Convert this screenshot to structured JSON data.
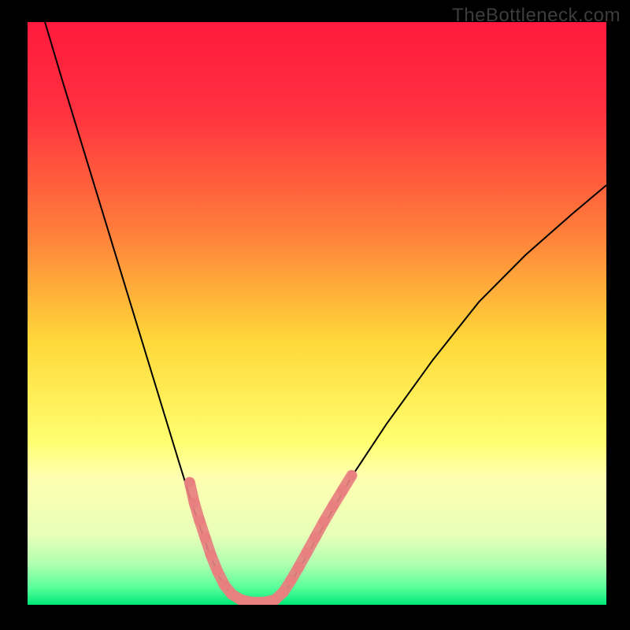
{
  "watermark": "TheBottleneck.com",
  "chart_data": {
    "type": "line",
    "title": "",
    "xlabel": "",
    "ylabel": "",
    "xlim": [
      0,
      100
    ],
    "ylim": [
      0,
      100
    ],
    "gradient_stops": [
      {
        "offset": 0.0,
        "color": "#ff1a3d"
      },
      {
        "offset": 0.15,
        "color": "#ff3040"
      },
      {
        "offset": 0.35,
        "color": "#ff7a3a"
      },
      {
        "offset": 0.55,
        "color": "#ffd93a"
      },
      {
        "offset": 0.72,
        "color": "#ffff70"
      },
      {
        "offset": 0.78,
        "color": "#ffffb0"
      },
      {
        "offset": 0.88,
        "color": "#e8ffb8"
      },
      {
        "offset": 0.93,
        "color": "#b0ffb0"
      },
      {
        "offset": 0.97,
        "color": "#5aff9a"
      },
      {
        "offset": 1.0,
        "color": "#00e878"
      }
    ],
    "series": [
      {
        "name": "curve",
        "stroke": "#000000",
        "points": [
          {
            "x": 3.0,
            "y": 100.0
          },
          {
            "x": 6.0,
            "y": 90.0
          },
          {
            "x": 10.0,
            "y": 77.0
          },
          {
            "x": 14.0,
            "y": 64.0
          },
          {
            "x": 18.0,
            "y": 51.0
          },
          {
            "x": 22.0,
            "y": 38.0
          },
          {
            "x": 26.0,
            "y": 25.0
          },
          {
            "x": 28.5,
            "y": 17.0
          },
          {
            "x": 31.0,
            "y": 10.0
          },
          {
            "x": 33.0,
            "y": 5.0
          },
          {
            "x": 35.0,
            "y": 2.0
          },
          {
            "x": 37.5,
            "y": 0.5
          },
          {
            "x": 40.0,
            "y": 0.3
          },
          {
            "x": 42.5,
            "y": 0.5
          },
          {
            "x": 45.0,
            "y": 3.0
          },
          {
            "x": 48.0,
            "y": 8.0
          },
          {
            "x": 52.0,
            "y": 15.0
          },
          {
            "x": 56.0,
            "y": 22.0
          },
          {
            "x": 62.0,
            "y": 31.0
          },
          {
            "x": 70.0,
            "y": 42.0
          },
          {
            "x": 78.0,
            "y": 52.0
          },
          {
            "x": 86.0,
            "y": 60.0
          },
          {
            "x": 94.0,
            "y": 67.0
          },
          {
            "x": 100.0,
            "y": 72.0
          }
        ]
      },
      {
        "name": "overlay-dots",
        "stroke": "#e88080",
        "fill": "#e88080",
        "radius_px": 6,
        "points": [
          {
            "x": 28.0,
            "y": 21.0
          },
          {
            "x": 28.8,
            "y": 17.5
          },
          {
            "x": 29.7,
            "y": 14.5
          },
          {
            "x": 30.7,
            "y": 11.5
          },
          {
            "x": 31.7,
            "y": 8.5
          },
          {
            "x": 32.8,
            "y": 5.8
          },
          {
            "x": 34.0,
            "y": 3.4
          },
          {
            "x": 35.3,
            "y": 1.8
          },
          {
            "x": 36.8,
            "y": 0.9
          },
          {
            "x": 38.3,
            "y": 0.5
          },
          {
            "x": 39.8,
            "y": 0.4
          },
          {
            "x": 41.3,
            "y": 0.5
          },
          {
            "x": 42.8,
            "y": 0.9
          },
          {
            "x": 44.2,
            "y": 2.2
          },
          {
            "x": 45.5,
            "y": 4.2
          },
          {
            "x": 46.8,
            "y": 6.4
          },
          {
            "x": 48.2,
            "y": 8.9
          },
          {
            "x": 49.7,
            "y": 11.6
          },
          {
            "x": 51.2,
            "y": 14.3
          },
          {
            "x": 52.8,
            "y": 17.0
          },
          {
            "x": 54.4,
            "y": 19.6
          },
          {
            "x": 56.0,
            "y": 22.2
          }
        ]
      }
    ]
  }
}
